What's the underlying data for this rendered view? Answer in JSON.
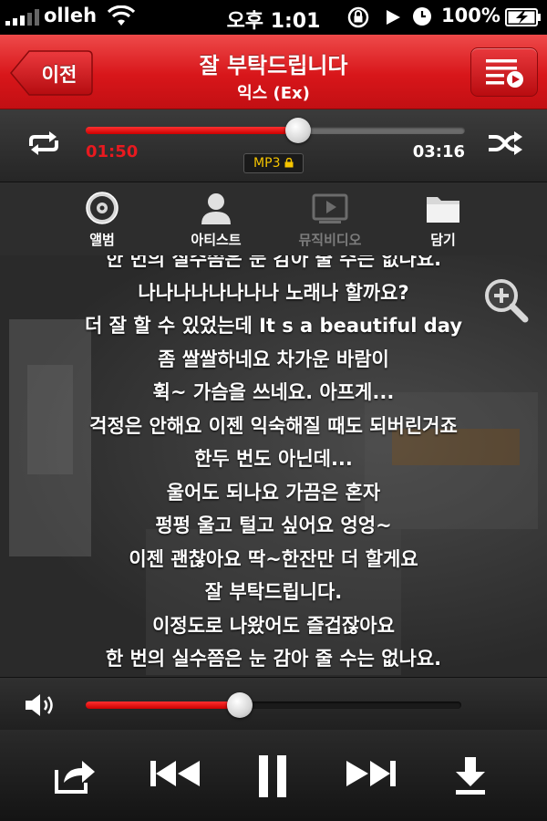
{
  "status_bar": {
    "carrier": "olleh",
    "time": "오후 1:01",
    "battery": "100%"
  },
  "header": {
    "back_label": "이전",
    "title": "잘 부탁드립니다",
    "artist": "익스 (Ex)"
  },
  "player": {
    "elapsed": "01:50",
    "duration": "03:16",
    "progress_fraction": 0.56,
    "format_badge": "MP3",
    "volume_fraction": 0.41
  },
  "tabs": [
    {
      "label": "앨범",
      "icon": "disc-icon",
      "enabled": true
    },
    {
      "label": "아티스트",
      "icon": "person-icon",
      "enabled": true
    },
    {
      "label": "뮤직비디오",
      "icon": "video-icon",
      "enabled": false
    },
    {
      "label": "담기",
      "icon": "folder-icon",
      "enabled": true
    }
  ],
  "lyrics": [
    "한 번의 실수쯤은 눈 감아 줄 수는 없나요.",
    "나나나나나나나나 노래나 할까요?",
    "더 잘 할 수 있었는데 It s a beautiful day",
    "좀 쌀쌀하네요 차가운 바람이",
    "휙~ 가슴을 쓰네요. 아프게...",
    "걱정은 안해요 이젠 익숙해질 때도 되버린거죠",
    "한두 번도 아닌데...",
    "울어도 되나요 가끔은 혼자",
    "펑펑 울고 털고 싶어요 엉엉~",
    "이젠 괜찮아요 딱~한잔만 더 할게요",
    "잘 부탁드립니다.",
    "이정도로 나왔어도 즐겁잖아요",
    "한 번의 실수쯤은 눈 감아 줄 수는 없나요.",
    "나나나나나나나나 노래나 할까요?",
    "더 잘 할 수 있었는데 It s a beautiful day"
  ],
  "colors": {
    "accent_red": "#e8191f",
    "header_red": "#d8161a",
    "badge_yellow": "#f5c400"
  }
}
